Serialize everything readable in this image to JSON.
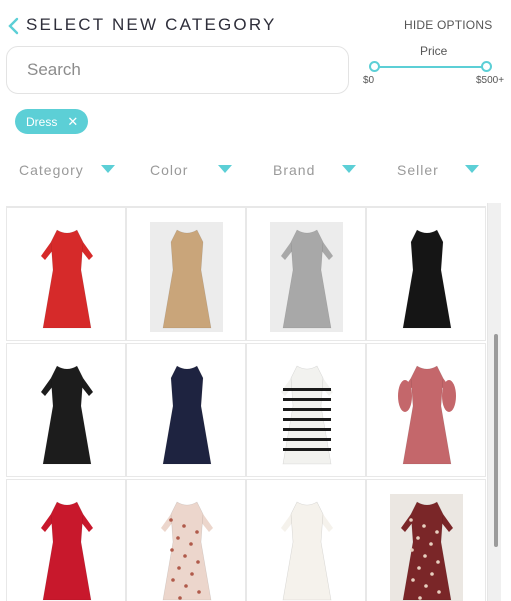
{
  "header": {
    "title": "SELECT NEW CATEGORY",
    "back_icon": "chevron-left-icon",
    "hide_options_label": "HIDE OPTIONS"
  },
  "search": {
    "placeholder": "Search",
    "value": ""
  },
  "price": {
    "label": "Price",
    "min_label": "$0",
    "max_label": "$500+"
  },
  "active_filters": [
    {
      "label": "Dress",
      "remove_icon": "close-icon"
    }
  ],
  "filters": [
    {
      "label": "Category",
      "icon": "caret-down-icon"
    },
    {
      "label": "Color",
      "icon": "caret-down-icon"
    },
    {
      "label": "Brand",
      "icon": "caret-down-icon"
    },
    {
      "label": "Seller",
      "icon": "caret-down-icon"
    }
  ],
  "products": [
    {
      "item": "red short-sleeve belted midi dress",
      "color": "#d62a2a"
    },
    {
      "item": "tan button-front pinafore dress",
      "color": "#c9a57a"
    },
    {
      "item": "grey ribbed t-shirt dress",
      "color": "#a8a8a8"
    },
    {
      "item": "black sleeveless midi dress",
      "color": "#151515"
    },
    {
      "item": "black cap-sleeve mini dress",
      "color": "#1c1c1c"
    },
    {
      "item": "navy lace halter mini dress",
      "color": "#1e2340"
    },
    {
      "item": "white black-striped sweater dress",
      "color": "#f2f2ef"
    },
    {
      "item": "dusty pink puff-sleeve dress",
      "color": "#c4676b"
    },
    {
      "item": "red mock-neck slit midi dress",
      "color": "#c8182c"
    },
    {
      "item": "pink floral print midi dress",
      "color": "#ecd6cc"
    },
    {
      "item": "white long-sleeve mini dress",
      "color": "#f5f2ec"
    },
    {
      "item": "burgundy pattern shirt dress",
      "color": "#7a2628"
    }
  ],
  "theme": {
    "accent": "#5ccfd6"
  }
}
